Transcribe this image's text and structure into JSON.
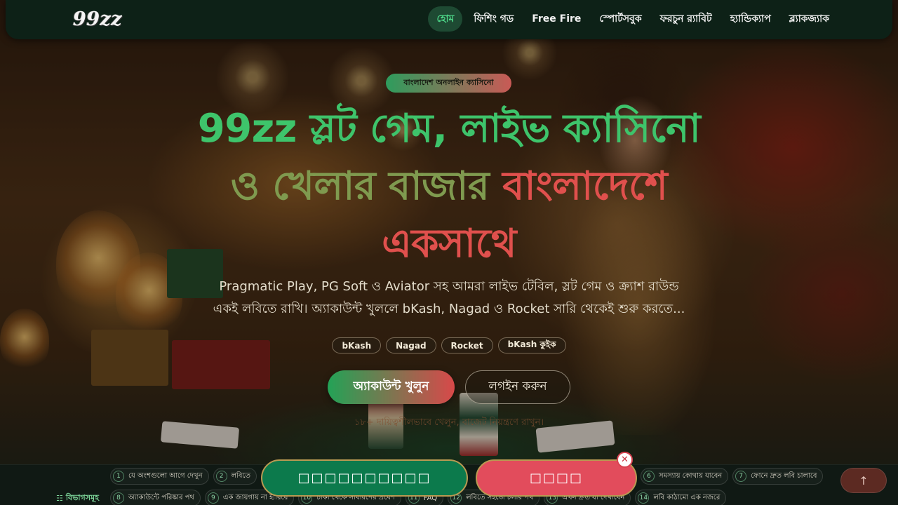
{
  "brand": {
    "logo_text": "99zz"
  },
  "nav": {
    "items": [
      {
        "label": "হোম",
        "active": true
      },
      {
        "label": "ফিশিং গড",
        "active": false
      },
      {
        "label": "Free Fire",
        "active": false
      },
      {
        "label": "স্পোর্টসবুক",
        "active": false
      },
      {
        "label": "ফরচুন র‍্যাবিট",
        "active": false
      },
      {
        "label": "হ্যান্ডিক্যাপ",
        "active": false
      },
      {
        "label": "ব্ল্যাকজ্যাক",
        "active": false
      }
    ]
  },
  "hero": {
    "badge": "বাংলাদেশ অনলাইন ক্যাসিনো",
    "headline": {
      "part1": "99zz স্লট গেম, লাইভ ক্যাসিনো",
      "part2": "ও খেলার বাজার",
      "part3": "বাংলাদেশে",
      "part4": "একসাথে"
    },
    "subtext_line1": "Pragmatic Play, PG Soft ও Aviator সহ আমরা লাইভ টেবিল, স্লট গেম ও ক্র্যাশ রাউন্ড",
    "subtext_line2": "একই লবিতে রাখি। অ্যাকাউন্ট খুললে bKash, Nagad ও Rocket সারি থেকেই শুরু করতে...",
    "payments": [
      "bKash",
      "Nagad",
      "Rocket",
      "bKash কুইক"
    ],
    "cta_primary": "অ্যাকাউন্ট খুলুন",
    "cta_secondary": "লগইন করুন",
    "disclaimer": "১৮+ দায়িত্বশীলভাবে খেলুন, বাজেট নিয়ন্ত্রণে রাখুন।"
  },
  "toc": {
    "label": "বিভাগসমূহ",
    "row1": [
      {
        "num": "1",
        "label": "যে অংশগুলো আগে দেখুন"
      },
      {
        "num": "2",
        "label": "লবিতে"
      },
      {
        "num": "6",
        "label": "সমস্যায় কোথায় যাবেন"
      },
      {
        "num": "7",
        "label": "ফোনে দ্রুত লবি চালাবে"
      }
    ],
    "row2": [
      {
        "num": "8",
        "label": "অ্যাকাউন্টে পরিষ্কার পথ"
      },
      {
        "num": "9",
        "label": "এক জায়গায় না হারিয়ে"
      },
      {
        "num": "10",
        "label": "চাকা থেকে সাধারণের প্রবেশ"
      },
      {
        "num": "11",
        "label": "FAQ"
      },
      {
        "num": "12",
        "label": "লবিতে সহজে চলার পথ"
      },
      {
        "num": "13",
        "label": "এখন দ্রুত যা দেখাবেন"
      },
      {
        "num": "14",
        "label": "লবি কাঠামো এক নজরে"
      }
    ]
  },
  "sticky": {
    "primary_label": "□□□□□□□□□□",
    "secondary_label": "□□□□",
    "close_label": "✕"
  },
  "to_top_label": "↑",
  "colors": {
    "nav_bg": "#0d2117",
    "accent_green": "#3ec46b",
    "accent_red": "#e0504d",
    "sticky_green": "#0c7a4c",
    "sticky_red": "#e24c5c"
  }
}
